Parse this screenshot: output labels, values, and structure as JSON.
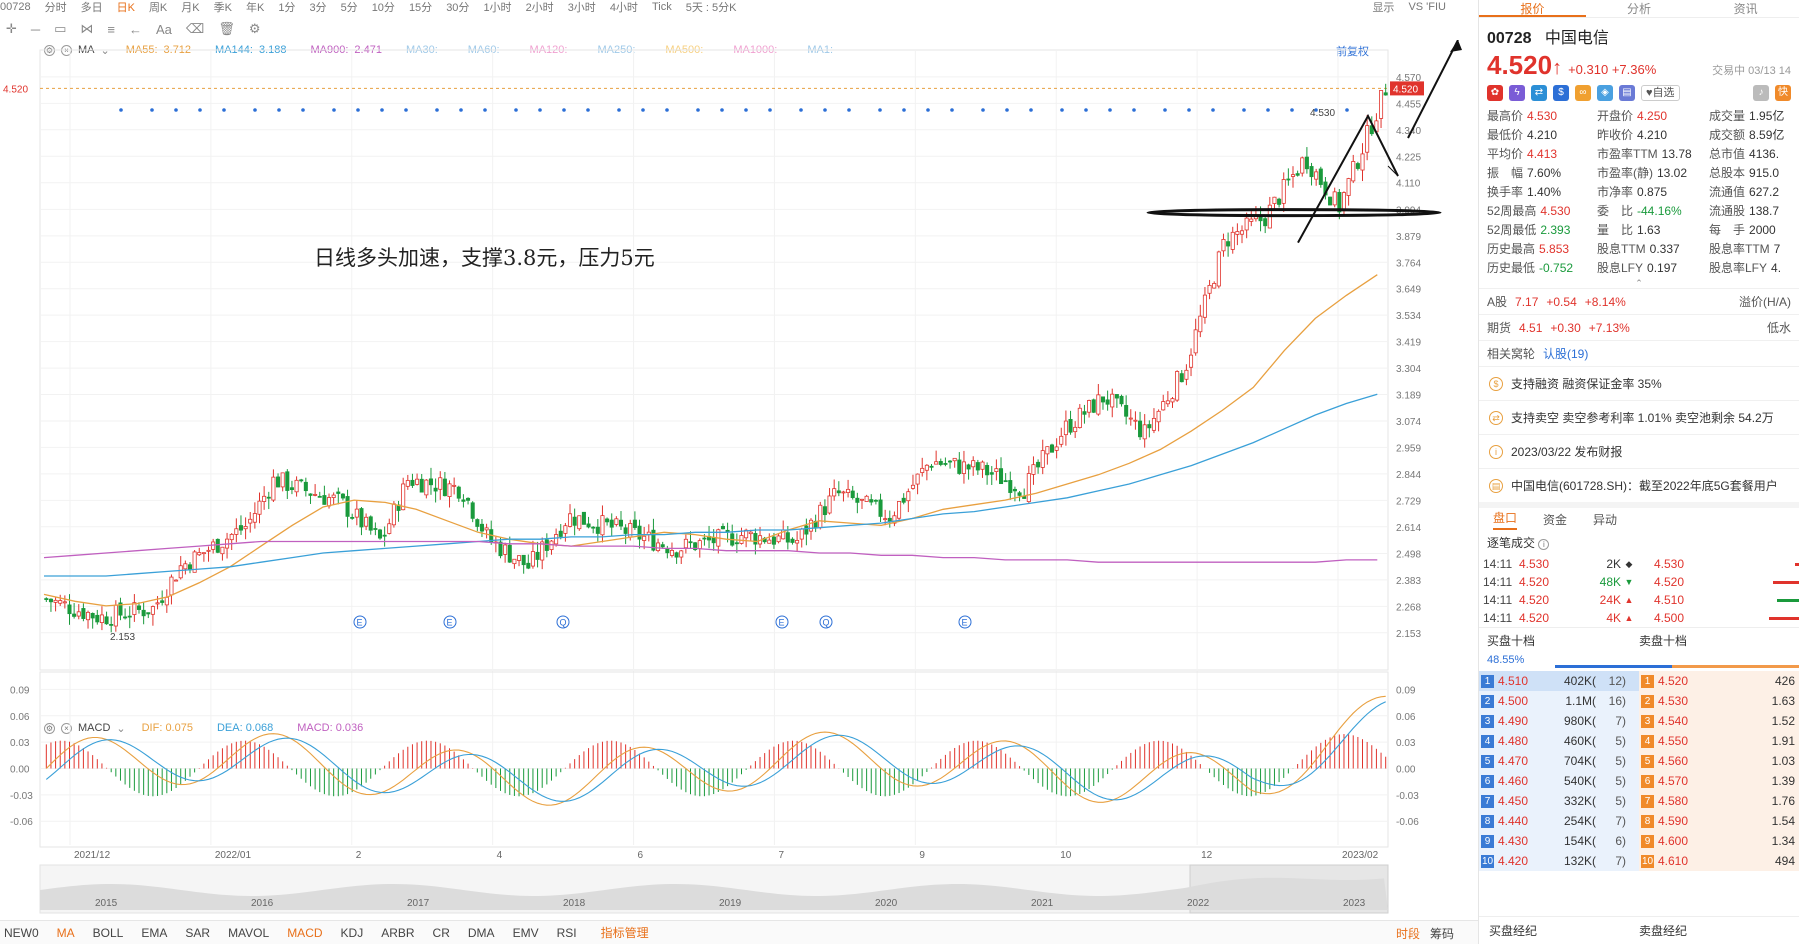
{
  "toolbar": {
    "items": [
      "00728",
      "分时",
      "多日",
      "日K",
      "周K",
      "月K",
      "季K",
      "年K",
      "1分",
      "3分",
      "5分",
      "10分",
      "15分",
      "30分",
      "1小时",
      "2小时",
      "3小时",
      "4小时",
      "Tick",
      "5天 : 5分K"
    ],
    "active_index": 3,
    "display_label": "显示",
    "vs_label": "VS 'FIU"
  },
  "indicators_main": {
    "ma_label": "MA",
    "items": [
      {
        "label": "MA55:",
        "value": "3.712",
        "color": "#e8a040"
      },
      {
        "label": "MA144:",
        "value": "3.188",
        "color": "#3aa0d8"
      },
      {
        "label": "MA900:",
        "value": "2.471",
        "color": "#c060c0"
      },
      {
        "label": "MA30:",
        "value": "",
        "color": "#9fc9e8"
      },
      {
        "label": "MA60:",
        "value": "",
        "color": "#9fc9e8"
      },
      {
        "label": "MA120:",
        "value": "",
        "color": "#f0a0d0"
      },
      {
        "label": "MA250:",
        "value": "",
        "color": "#9fc9e8"
      },
      {
        "label": "MA500:",
        "value": "",
        "color": "#f7d080"
      },
      {
        "label": "MA1000:",
        "value": "",
        "color": "#f0a0d0"
      },
      {
        "label": "MA1:",
        "value": "",
        "color": "#9fc9e8"
      }
    ],
    "adjust_label": "前复权"
  },
  "indicators_macd": {
    "label": "MACD",
    "dif": "DIF: 0.075",
    "dea": "DEA: 0.068",
    "macd": "MACD: 0.036"
  },
  "annotation": "日线多头加速，支撑3.8元，压力5元",
  "chart_data": {
    "type": "candlestick",
    "price_axis": [
      "4.570",
      "4.455",
      "4.340",
      "4.225",
      "4.110",
      "3.994",
      "3.879",
      "3.764",
      "3.649",
      "3.534",
      "3.419",
      "3.304",
      "3.189",
      "3.074",
      "2.959",
      "2.844",
      "2.729",
      "2.614",
      "2.498",
      "2.383",
      "2.268",
      "2.153"
    ],
    "ylim": [
      2.1,
      4.6
    ],
    "current_price": "4.520",
    "high_label": "4.530",
    "low_label": "2.153",
    "macd_axis": [
      "0.09",
      "0.06",
      "0.03",
      "0.00",
      "-0.03",
      "-0.06"
    ],
    "x_labels": [
      "2021/12",
      "2022/01",
      "2",
      "4",
      "6",
      "7",
      "9",
      "10",
      "12",
      "2023/02"
    ],
    "overview_years": [
      "2015",
      "2016",
      "2017",
      "2018",
      "2019",
      "2020",
      "2021",
      "2022",
      "2023"
    ],
    "support_level": 3.98,
    "events": [
      "E",
      "E",
      "Q",
      "E",
      "Q",
      "E"
    ],
    "series": [
      {
        "name": "MA55",
        "values": [
          2.32,
          2.29,
          2.27,
          2.28,
          2.31,
          2.37,
          2.44,
          2.53,
          2.62,
          2.7,
          2.73,
          2.72,
          2.69,
          2.64,
          2.59,
          2.56,
          2.54,
          2.53,
          2.55,
          2.57,
          2.59,
          2.58,
          2.56,
          2.55,
          2.6,
          2.64,
          2.63,
          2.62,
          2.65,
          2.69,
          2.71,
          2.73,
          2.76,
          2.8,
          2.84,
          2.89,
          2.95,
          3.03,
          3.12,
          3.22,
          3.38,
          3.52,
          3.62,
          3.71
        ]
      },
      {
        "name": "MA144",
        "values": [
          2.4,
          2.4,
          2.4,
          2.41,
          2.42,
          2.43,
          2.44,
          2.46,
          2.48,
          2.5,
          2.51,
          2.52,
          2.53,
          2.54,
          2.55,
          2.56,
          2.56,
          2.57,
          2.57,
          2.58,
          2.58,
          2.59,
          2.59,
          2.6,
          2.6,
          2.61,
          2.62,
          2.63,
          2.65,
          2.67,
          2.68,
          2.7,
          2.72,
          2.74,
          2.77,
          2.8,
          2.84,
          2.88,
          2.93,
          2.98,
          3.04,
          3.1,
          3.15,
          3.19
        ]
      },
      {
        "name": "MA900",
        "values": [
          2.48,
          2.49,
          2.5,
          2.51,
          2.52,
          2.53,
          2.54,
          2.55,
          2.55,
          2.55,
          2.55,
          2.55,
          2.55,
          2.55,
          2.55,
          2.54,
          2.54,
          2.53,
          2.53,
          2.53,
          2.52,
          2.52,
          2.51,
          2.51,
          2.51,
          2.5,
          2.5,
          2.49,
          2.49,
          2.48,
          2.48,
          2.47,
          2.47,
          2.47,
          2.46,
          2.46,
          2.46,
          2.46,
          2.46,
          2.46,
          2.46,
          2.46,
          2.47,
          2.47
        ]
      }
    ]
  },
  "bottom_tabs": {
    "items": [
      "NEW0",
      "MA",
      "BOLL",
      "EMA",
      "SAR",
      "MAVOL",
      "MACD",
      "KDJ",
      "ARBR",
      "CR",
      "DMA",
      "EMV",
      "RSI"
    ],
    "manage": "指标管理",
    "right": [
      "时段",
      "筹码"
    ]
  },
  "panel": {
    "tabs": [
      "报价",
      "分析",
      "资讯"
    ],
    "code": "00728",
    "name": "中国电信",
    "price": "4.520",
    "arrow": "↑",
    "change": "+0.310 +7.36%",
    "trade_time": "交易中 03/13 14",
    "fav_label": "♥自选",
    "quote": [
      {
        "k": "最高价",
        "v": "4.530",
        "c": "red"
      },
      {
        "k": "开盘价",
        "v": "4.250",
        "c": "red"
      },
      {
        "k": "成交量",
        "v": "1.95亿",
        "c": ""
      },
      {
        "k": "最低价",
        "v": "4.210",
        "c": ""
      },
      {
        "k": "昨收价",
        "v": "4.210",
        "c": ""
      },
      {
        "k": "成交额",
        "v": "8.59亿",
        "c": ""
      },
      {
        "k": "平均价",
        "v": "4.413",
        "c": "red"
      },
      {
        "k": "市盈率TTM",
        "v": "13.78",
        "c": ""
      },
      {
        "k": "总市值",
        "v": "4136.",
        "c": ""
      },
      {
        "k": "振　幅",
        "v": "7.60%",
        "c": ""
      },
      {
        "k": "市盈率(静)",
        "v": "13.02",
        "c": ""
      },
      {
        "k": "总股本",
        "v": "915.0",
        "c": ""
      },
      {
        "k": "换手率",
        "v": "1.40%",
        "c": ""
      },
      {
        "k": "市净率",
        "v": "0.875",
        "c": ""
      },
      {
        "k": "流通值",
        "v": "627.2",
        "c": ""
      },
      {
        "k": "52周最高",
        "v": "4.530",
        "c": "red"
      },
      {
        "k": "委　比",
        "v": "-44.16%",
        "c": "green"
      },
      {
        "k": "流通股",
        "v": "138.7",
        "c": ""
      },
      {
        "k": "52周最低",
        "v": "2.393",
        "c": "green"
      },
      {
        "k": "量　比",
        "v": "1.63",
        "c": ""
      },
      {
        "k": "每　手",
        "v": "2000",
        "c": ""
      },
      {
        "k": "历史最高",
        "v": "5.853",
        "c": "red"
      },
      {
        "k": "股息TTM",
        "v": "0.337",
        "c": ""
      },
      {
        "k": "股息率TTM",
        "v": "7",
        "c": ""
      },
      {
        "k": "历史最低",
        "v": "-0.752",
        "c": "green"
      },
      {
        "k": "股息LFY",
        "v": "0.197",
        "c": ""
      },
      {
        "k": "股息率LFY",
        "v": "4.",
        "c": ""
      }
    ],
    "a_share": {
      "label": "A股",
      "price": "7.17",
      "chg": "+0.54",
      "pct": "+8.14%",
      "premium": "溢价(H/A)"
    },
    "futures": {
      "label": "期货",
      "price": "4.51",
      "chg": "+0.30",
      "pct": "+7.13%",
      "extra": "低水"
    },
    "related": {
      "label": "相关窝轮",
      "value": "认股(19)"
    },
    "notices": [
      "支持融资  融资保证金率 35%",
      "支持卖空  卖空参考利率 1.01%  卖空池剩余 54.2万",
      "2023/03/22  发布财报",
      "中国电信(601728.SH)：截至2022年底5G套餐用户"
    ],
    "subtabs": [
      "盘口",
      "资金",
      "异动"
    ],
    "tick_title": "逐笔成交",
    "ticks": [
      {
        "t": "14:11",
        "p": "4.530",
        "q": "2K",
        "d": "◆",
        "c": ""
      },
      {
        "t": "14:11",
        "p": "4.520",
        "q": "48K",
        "d": "▼",
        "c": "green"
      },
      {
        "t": "14:11",
        "p": "4.520",
        "q": "24K",
        "d": "▲",
        "c": "red"
      },
      {
        "t": "14:11",
        "p": "4.520",
        "q": "4K",
        "d": "▲",
        "c": "red"
      }
    ],
    "mini_levels": [
      "4.530",
      "4.520",
      "4.510",
      "4.500"
    ],
    "bid_title": "买盘十档",
    "ask_title": "卖盘十档",
    "bid_ratio": "48.55%",
    "bids": [
      {
        "i": "1",
        "p": "4.510",
        "v": "402K(",
        "n": "12)"
      },
      {
        "i": "2",
        "p": "4.500",
        "v": "1.1M(",
        "n": "16)"
      },
      {
        "i": "3",
        "p": "4.490",
        "v": "980K(",
        "n": "7)"
      },
      {
        "i": "4",
        "p": "4.480",
        "v": "460K(",
        "n": "5)"
      },
      {
        "i": "5",
        "p": "4.470",
        "v": "704K(",
        "n": "5)"
      },
      {
        "i": "6",
        "p": "4.460",
        "v": "540K(",
        "n": "5)"
      },
      {
        "i": "7",
        "p": "4.450",
        "v": "332K(",
        "n": "5)"
      },
      {
        "i": "8",
        "p": "4.440",
        "v": "254K(",
        "n": "7)"
      },
      {
        "i": "9",
        "p": "4.430",
        "v": "154K(",
        "n": "6)"
      },
      {
        "i": "10",
        "p": "4.420",
        "v": "132K(",
        "n": "7)"
      }
    ],
    "asks": [
      {
        "i": "1",
        "p": "4.520",
        "v": "426"
      },
      {
        "i": "2",
        "p": "4.530",
        "v": "1.63"
      },
      {
        "i": "3",
        "p": "4.540",
        "v": "1.52"
      },
      {
        "i": "4",
        "p": "4.550",
        "v": "1.91"
      },
      {
        "i": "5",
        "p": "4.560",
        "v": "1.03"
      },
      {
        "i": "6",
        "p": "4.570",
        "v": "1.39"
      },
      {
        "i": "7",
        "p": "4.580",
        "v": "1.76"
      },
      {
        "i": "8",
        "p": "4.590",
        "v": "1.54"
      },
      {
        "i": "9",
        "p": "4.600",
        "v": "1.34"
      },
      {
        "i": "10",
        "p": "4.610",
        "v": "494"
      }
    ],
    "foot": [
      "买盘经纪",
      "卖盘经纪"
    ]
  }
}
